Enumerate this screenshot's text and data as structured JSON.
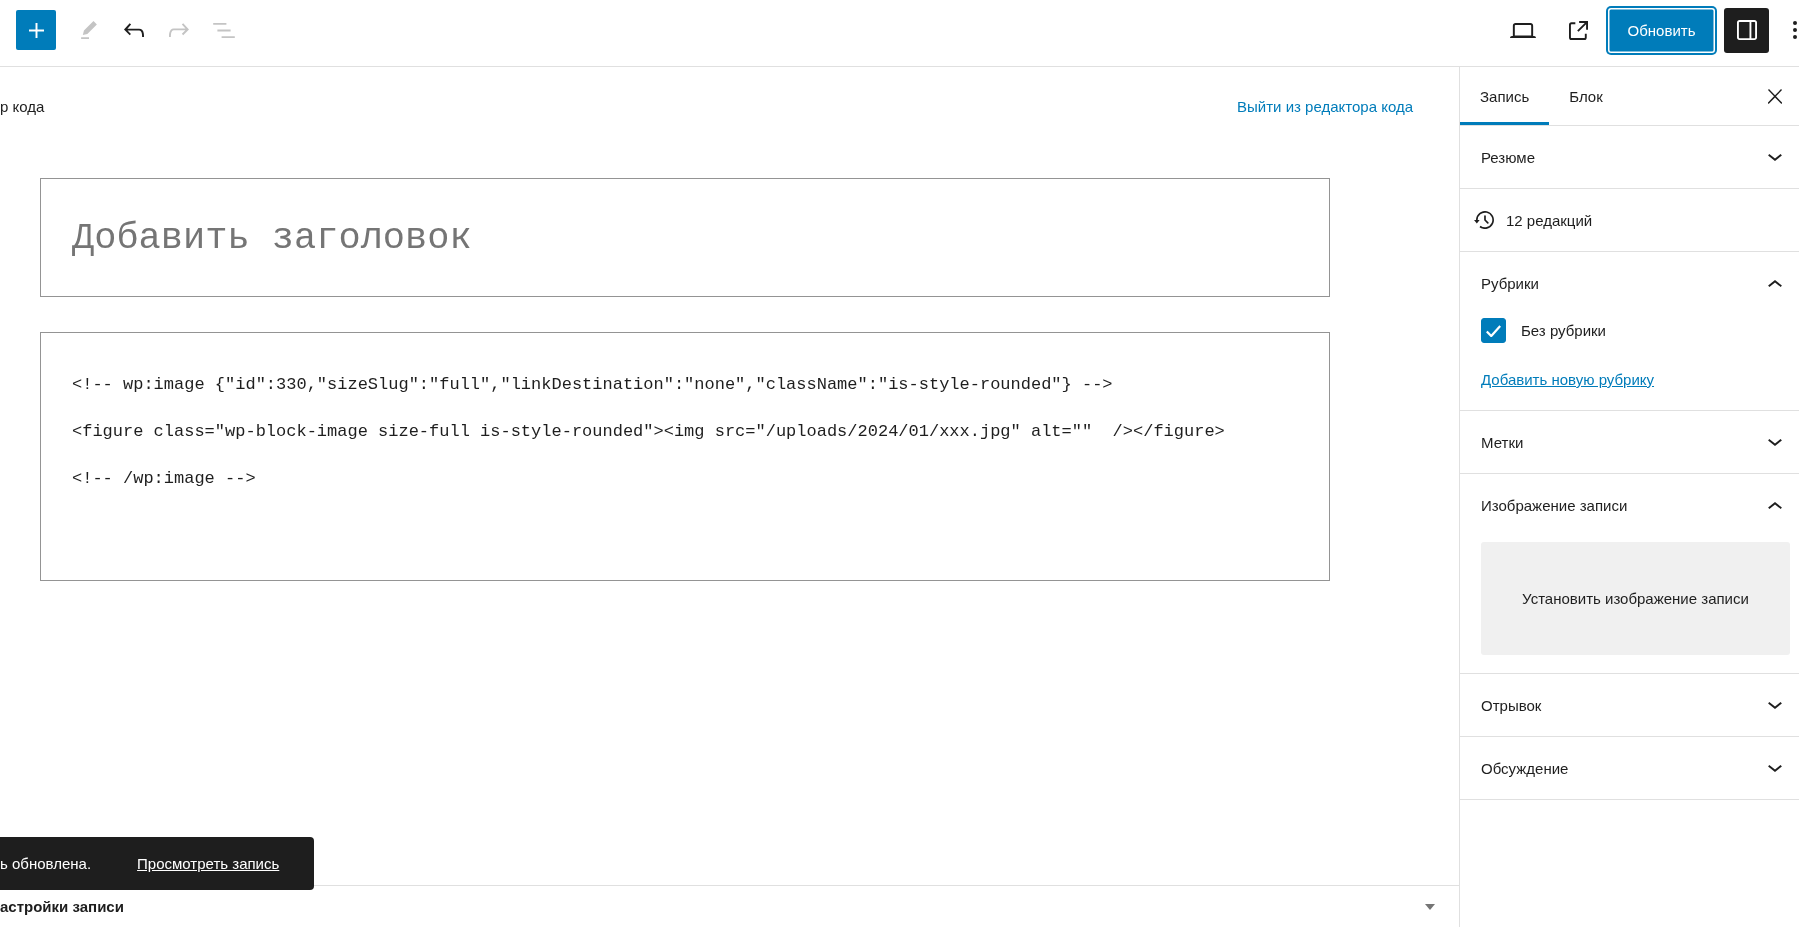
{
  "header": {
    "tools": [
      {
        "kind": "edit",
        "disabled": true
      },
      {
        "kind": "undo",
        "disabled": false
      },
      {
        "kind": "redo",
        "disabled": true
      },
      {
        "kind": "outline",
        "disabled": true
      }
    ],
    "update_button": {
      "label": "Обновить",
      "focused": true
    },
    "settings_button": {
      "pressed": true
    }
  },
  "editor": {
    "mode_label": "р кода",
    "exit_link": "Выйти из редактора кода",
    "title_field": {
      "placeholder": "Добавить заголовок"
    },
    "code_lines": [
      "<!-- wp:image {\"id\":330,\"sizeSlug\":\"full\",\"linkDestination\":\"none\",\"className\":\"is-style-rounded\"} -->",
      "<figure class=\"wp-block-image size-full is-style-rounded\"><img src=\"/uploads/2024/01/xxx.jpg\" alt=\"\"  /></figure>",
      "<!-- /wp:image -->"
    ]
  },
  "sidebar": {
    "tabs": [
      {
        "label": "Запись",
        "selected": true
      },
      {
        "label": "Блок",
        "selected": false
      }
    ],
    "sections": [
      {
        "kind": "panel",
        "title": "Резюме",
        "expanded": false
      },
      {
        "kind": "revisions",
        "label": "12 редакций"
      },
      {
        "kind": "panel",
        "title": "Рубрики",
        "expanded": true,
        "categories": [
          {
            "label": "Без рубрики",
            "checked": true
          }
        ],
        "add_link": "Добавить новую рубрику"
      },
      {
        "kind": "panel",
        "title": "Метки",
        "expanded": false
      },
      {
        "kind": "panel",
        "title": "Изображение записи",
        "expanded": true,
        "set_image_button": "Установить изображение записи"
      },
      {
        "kind": "panel",
        "title": "Отрывок",
        "expanded": false
      },
      {
        "kind": "panel",
        "title": "Обсуждение",
        "expanded": false
      }
    ]
  },
  "snackbar": {
    "message": "ь обновлена.",
    "link": "Просмотреть запись"
  },
  "meta_boxes": {
    "title": "астройки записи",
    "expanded": false
  }
}
